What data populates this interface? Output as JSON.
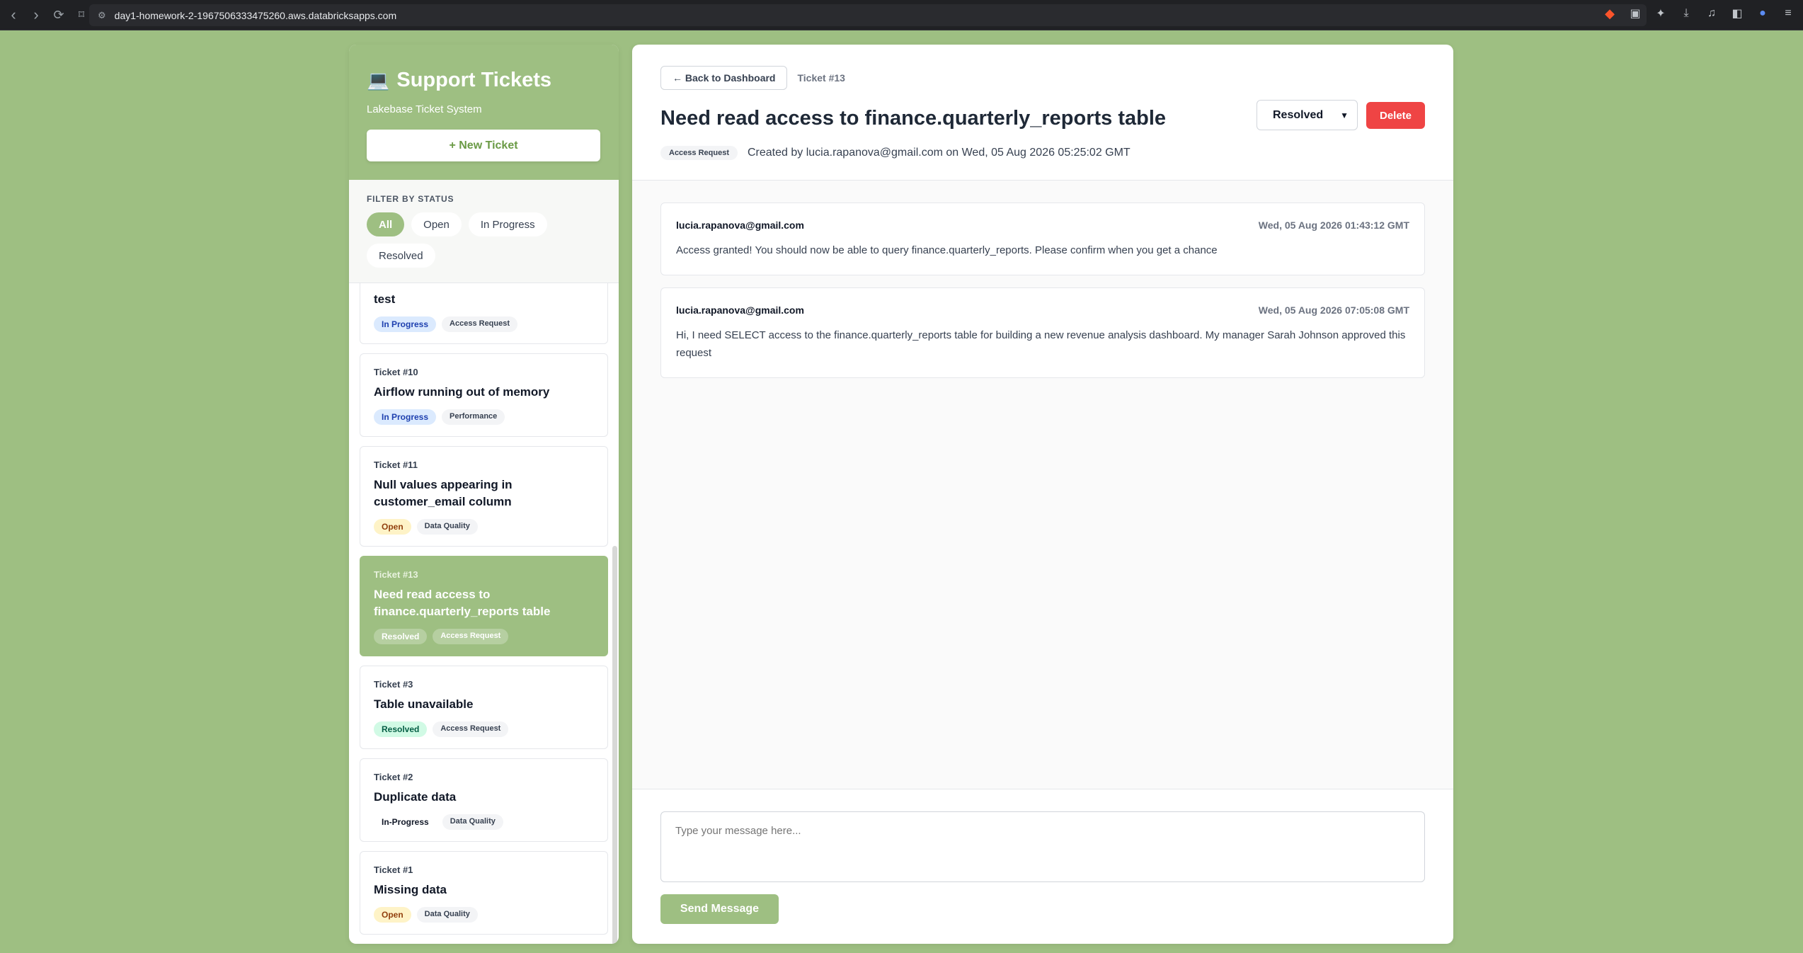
{
  "browser": {
    "url": "day1-homework-2-1967506333475260.aws.databricksapps.com"
  },
  "sidebar": {
    "title": "Support Tickets",
    "subtitle": "Lakebase Ticket System",
    "new_ticket_label": "+ New Ticket",
    "filter_label": "FILTER BY STATUS",
    "filters": [
      "All",
      "Open",
      "In Progress",
      "Resolved"
    ],
    "active_filter": "All",
    "tickets": [
      {
        "id": "",
        "title": "test",
        "status": "In Progress",
        "category": "Access Request"
      },
      {
        "id": "Ticket #10",
        "title": "Airflow running out of memory",
        "status": "In Progress",
        "category": "Performance"
      },
      {
        "id": "Ticket #11",
        "title": "Null values appearing in customer_email column",
        "status": "Open",
        "category": "Data Quality"
      },
      {
        "id": "Ticket #13",
        "title": "Need read access to finance.quarterly_reports table",
        "status": "Resolved",
        "category": "Access Request"
      },
      {
        "id": "Ticket #3",
        "title": "Table unavailable",
        "status": "Resolved",
        "category": "Access Request"
      },
      {
        "id": "Ticket #2",
        "title": "Duplicate data",
        "status": "In-Progress",
        "category": "Data Quality"
      },
      {
        "id": "Ticket #1",
        "title": "Missing data",
        "status": "Open",
        "category": "Data Quality"
      }
    ]
  },
  "detail": {
    "back_label": "← Back to Dashboard",
    "ticket_ref": "Ticket #13",
    "title": "Need read access to finance.quarterly_reports table",
    "category": "Access Request",
    "created_text": "Created by lucia.rapanova@gmail.com on Wed, 05 Aug 2026 05:25:02 GMT",
    "status_value": "Resolved",
    "delete_label": "Delete",
    "messages": [
      {
        "author": "lucia.rapanova@gmail.com",
        "time": "Wed, 05 Aug 2026 01:43:12 GMT",
        "body": "Access granted! You should now be able to query finance.quarterly_reports. Please confirm when you get a chance"
      },
      {
        "author": "lucia.rapanova@gmail.com",
        "time": "Wed, 05 Aug 2026 07:05:08 GMT",
        "body": "Hi, I need SELECT access to the finance.quarterly_reports table for building a new revenue analysis dashboard. My manager Sarah Johnson approved this request"
      }
    ],
    "message_placeholder": "Type your message here...",
    "send_label": "Send Message"
  }
}
